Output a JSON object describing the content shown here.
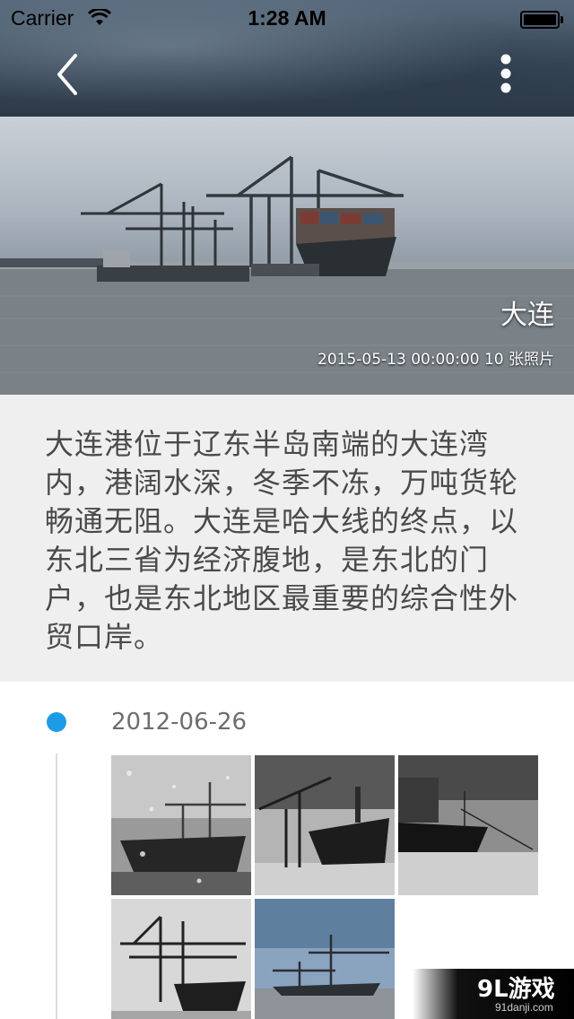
{
  "status_bar": {
    "carrier": "Carrier",
    "time": "1:28 AM"
  },
  "nav": {
    "back_icon": "chevron-left-icon",
    "more_icon": "vertical-ellipsis-icon"
  },
  "hero": {
    "title": "大连",
    "meta": "2015-05-13 00:00:00 10 张照片"
  },
  "description": {
    "text": "大连港位于辽东半岛南端的大连湾内，港阔水深，冬季不冻，万吨货轮畅通无阻。大连是哈大线的终点，以东北三省为经济腹地，是东北的门户，也是东北地区最重要的综合性外贸口岸。"
  },
  "timeline": {
    "entries": [
      {
        "date": "2012-06-26",
        "photo_count_shown": 5
      }
    ],
    "accent_color": "#1e9be6"
  },
  "watermark": {
    "logo": "9L游戏",
    "url": "91danji.com"
  }
}
